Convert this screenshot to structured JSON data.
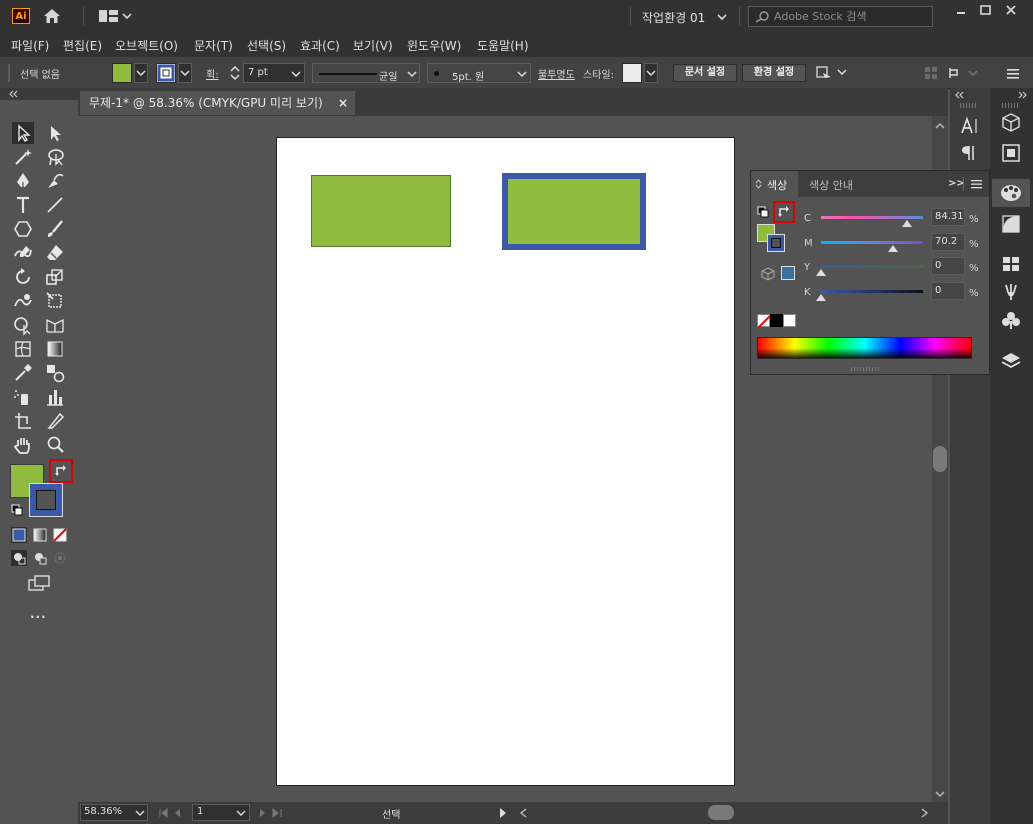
{
  "titlebar": {
    "app_logo": "Ai",
    "workspace": "작업환경 01",
    "search_placeholder": "Adobe Stock 검색"
  },
  "menu": [
    "파일(F)",
    "편집(E)",
    "오브젝트(O)",
    "문자(T)",
    "선택(S)",
    "효과(C)",
    "보기(V)",
    "윈도우(W)",
    "도움말(H)"
  ],
  "control": {
    "selection_status": "선택 없음",
    "stroke_label": "획:",
    "stroke_weight": "7 pt",
    "stroke_profile": "균일",
    "brush": "5pt. 원",
    "opacity_label": "불투명도",
    "style_label": "스타일:",
    "doc_setup": "문서 설정",
    "preferences": "환경 설정"
  },
  "document": {
    "tab_title": "무제-1* @ 58.36% (CMYK/GPU 미리 보기)",
    "close": "×"
  },
  "status": {
    "zoom": "58.36%",
    "page": "1",
    "mode": "선택"
  },
  "color_panel": {
    "tab_color": "색상",
    "tab_guide": "색상 안내",
    "collapse": ">>",
    "channels": [
      {
        "label": "C",
        "value": "84.31",
        "unit": "%",
        "level": 0.8431
      },
      {
        "label": "M",
        "value": "70.2",
        "unit": "%",
        "level": 0.702
      },
      {
        "label": "Y",
        "value": "0",
        "unit": "%",
        "level": 0
      },
      {
        "label": "K",
        "value": "0",
        "unit": "%",
        "level": 0
      }
    ]
  },
  "colors": {
    "fill": "#8fbc3f",
    "stroke": "#3a5aa8",
    "highlight": "#e00000"
  },
  "toolbar": {
    "more": "..."
  }
}
